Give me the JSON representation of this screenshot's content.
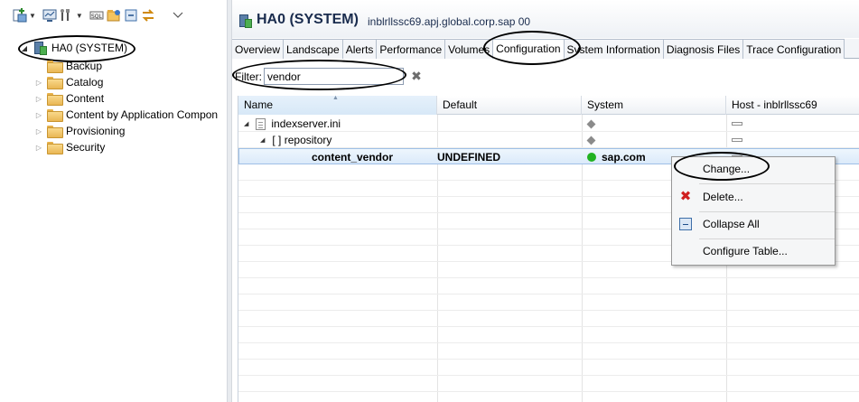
{
  "left_pane": {
    "toolbar_icons": [
      "new-connection-icon",
      "system-monitor-icon",
      "tools-icon",
      "sql-console-icon",
      "open-folder-icon",
      "collapse-all-icon",
      "link-with-editor-icon",
      "view-menu-icon"
    ],
    "tree": {
      "system_label": "HA0 (SYSTEM)",
      "children": [
        {
          "label": "Backup"
        },
        {
          "label": "Catalog"
        },
        {
          "label": "Content"
        },
        {
          "label": "Content by Application Compon"
        },
        {
          "label": "Provisioning"
        },
        {
          "label": "Security"
        }
      ]
    }
  },
  "editor": {
    "title": "HA0 (SYSTEM)",
    "host": "inblrllssc69.apj.global.corp.sap 00",
    "tabs": [
      {
        "label": "Overview"
      },
      {
        "label": "Landscape"
      },
      {
        "label": "Alerts"
      },
      {
        "label": "Performance"
      },
      {
        "label": "Volumes"
      },
      {
        "label": "Configuration",
        "active": true
      },
      {
        "label": "System Information"
      },
      {
        "label": "Diagnosis Files"
      },
      {
        "label": "Trace Configuration"
      }
    ],
    "filter": {
      "label": "Filter:",
      "value": "vendor"
    },
    "table": {
      "columns": [
        "Name",
        "Default",
        "System",
        "Host - inblrllssc69"
      ],
      "rows": [
        {
          "name": "indexserver.ini",
          "default": "",
          "system": "",
          "host": ""
        },
        {
          "name": "[ ] repository",
          "default": "",
          "system": "",
          "host": ""
        },
        {
          "name": "content_vendor",
          "default": "UNDEFINED",
          "system": "sap.com",
          "host": ""
        }
      ],
      "status_color": "#21b221"
    }
  },
  "context_menu": {
    "items": [
      {
        "label": "Change...",
        "icon": ""
      },
      {
        "label": "Delete...",
        "icon": "delete-icon"
      },
      {
        "label": "Collapse All",
        "icon": "collapse-all-icon"
      },
      {
        "label": "Configure Table...",
        "icon": ""
      }
    ]
  },
  "colors": {
    "selection": "#dbeafa",
    "header_text": "#1a2c4e"
  }
}
